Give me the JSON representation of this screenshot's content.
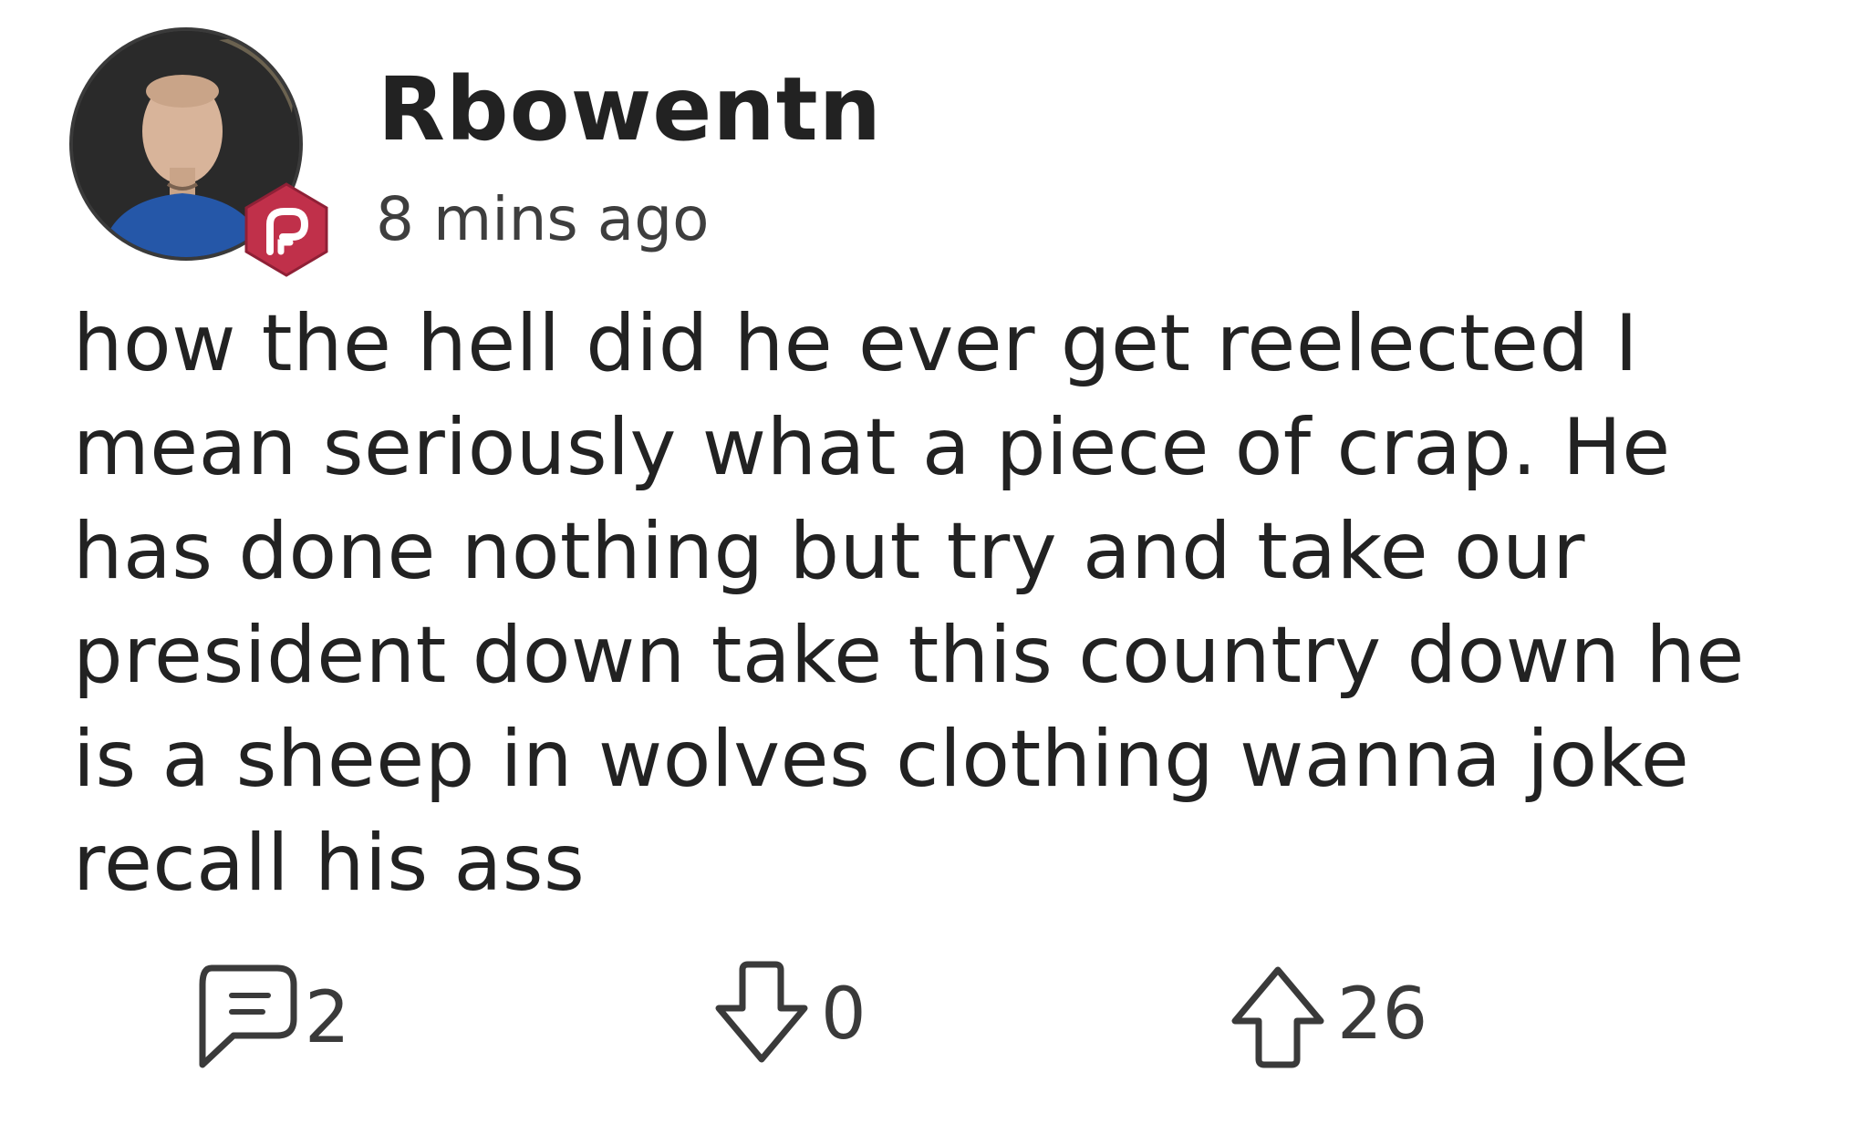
{
  "post": {
    "username": "Rbowentn",
    "timestamp": "8 mins ago",
    "body_lines": [
      "how the hell did he ever get reelected I",
      "mean seriously what a piece of crap. He",
      "has done nothing but try and take our",
      "president down take this country down he",
      "is a sheep in wolves clothing wanna joke",
      "recall his ass"
    ],
    "badge_icon": "parler-logo-icon",
    "badge_color": "#c0304a"
  },
  "actions": {
    "comments": {
      "icon": "comment-icon",
      "count": "2"
    },
    "downvotes": {
      "icon": "arrow-down-icon",
      "count": "0"
    },
    "upvotes": {
      "icon": "arrow-up-icon",
      "count": "26"
    }
  }
}
